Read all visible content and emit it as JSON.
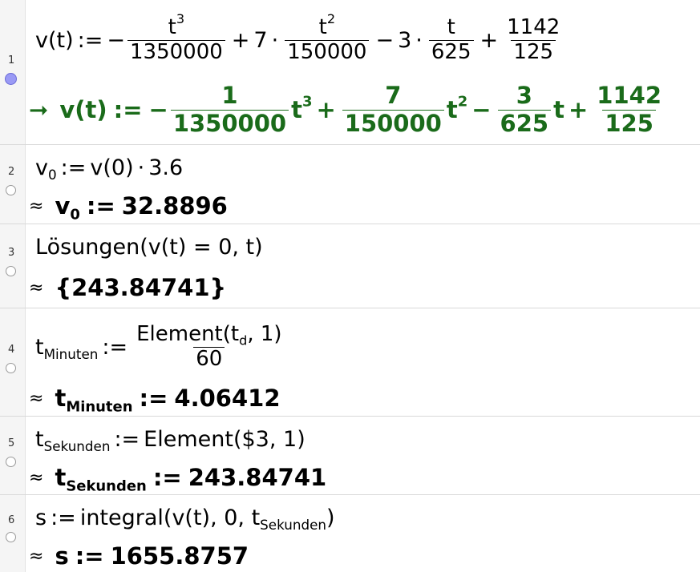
{
  "rows": [
    {
      "number": "1",
      "marble": "active",
      "input": {
        "lhs": "v(t)",
        "assign": ":=",
        "minus1": "−",
        "f1_num": "t",
        "f1_num_exp": "3",
        "f1_den": "1350000",
        "plus1": "+",
        "c2": "7",
        "dot": "·",
        "f2_num": "t",
        "f2_num_exp": "2",
        "f2_den": "150000",
        "minus2": "−",
        "c3": "3",
        "f3_num": "t",
        "f3_den": "625",
        "plus2": "+",
        "f4_num": "1142",
        "f4_den": "125"
      },
      "output": {
        "symbol": "➞",
        "lhs": "v(t)",
        "assign": ":=",
        "minus1": "−",
        "f1_num": "1",
        "f1_den": "1350000",
        "t": "t",
        "e3": "3",
        "e2": "2",
        "plus": "+",
        "f2_num": "7",
        "f2_den": "150000",
        "minus2": "−",
        "f3_num": "3",
        "f3_den": "625",
        "f4_num": "1142",
        "f4_den": "125"
      }
    },
    {
      "number": "2",
      "input": {
        "var": "v",
        "sub": "0",
        "assign": ":=",
        "rhs": "v(0)",
        "dot": "·",
        "factor": "3.6"
      },
      "output": {
        "symbol": "≈",
        "var": "v",
        "sub": "0",
        "assign": ":=",
        "value": "32.8896"
      }
    },
    {
      "number": "3",
      "input": {
        "text": "Lösungen(v(t) = 0, t)"
      },
      "output": {
        "symbol": "≈",
        "value": "{243.84741}"
      }
    },
    {
      "number": "4",
      "input": {
        "var": "t",
        "sub": "Minuten",
        "assign": ":=",
        "num_pre": "Element(t",
        "num_sub": "d",
        "num_post": ", 1)",
        "den": "60"
      },
      "output": {
        "symbol": "≈",
        "var": "t",
        "sub": "Minuten",
        "assign": ":=",
        "value": "4.06412"
      }
    },
    {
      "number": "5",
      "input": {
        "var": "t",
        "sub": "Sekunden",
        "assign": ":=",
        "rhs": "Element($3, 1)"
      },
      "output": {
        "symbol": "≈",
        "var": "t",
        "sub": "Sekunden",
        "assign": ":=",
        "value": "243.84741"
      }
    },
    {
      "number": "6",
      "input": {
        "var": "s",
        "assign": ":=",
        "rhs_pre": "integral(v(t), 0, t",
        "rhs_sub": "Sekunden",
        "rhs_post": ")"
      },
      "output": {
        "symbol": "≈",
        "var": "s",
        "assign": ":=",
        "value": "1655.8757"
      }
    }
  ]
}
